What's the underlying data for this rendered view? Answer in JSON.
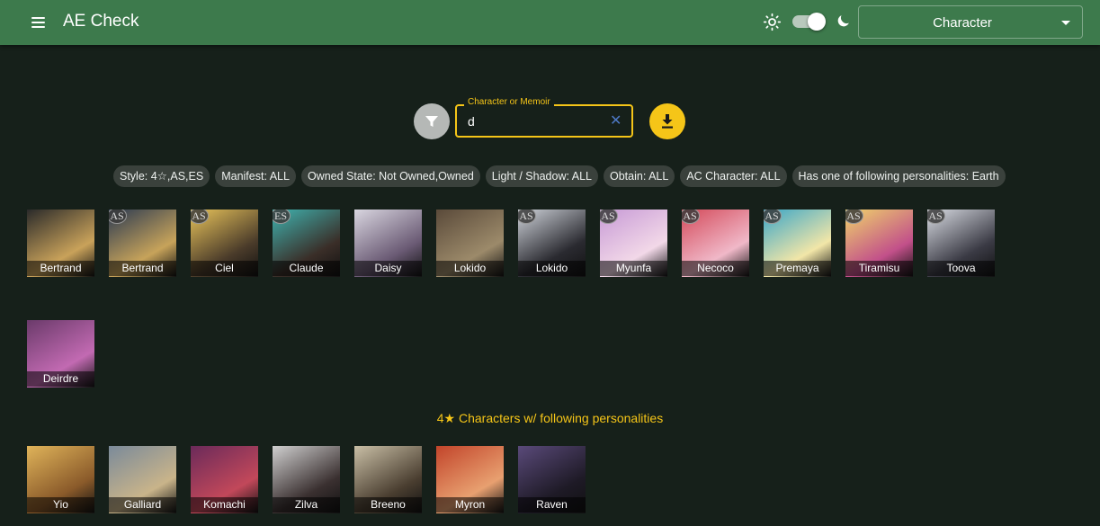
{
  "appbar": {
    "title": "AE Check",
    "dropdown_value": "Character"
  },
  "search": {
    "label": "Character or Memoir",
    "value": "d"
  },
  "filters": [
    "Style: 4☆,AS,ES",
    "Manifest: ALL",
    "Owned State: Not Owned,Owned",
    "Light / Shadow: ALL",
    "Obtain: ALL",
    "AC Character: ALL",
    "Has one of following personalities: Earth"
  ],
  "characters_row1": [
    {
      "name": "Bertrand",
      "badge": "",
      "colors": [
        "#2a2a2a",
        "#c9a25a"
      ]
    },
    {
      "name": "Bertrand",
      "badge": "AS",
      "colors": [
        "#2b3a52",
        "#c7a35a"
      ]
    },
    {
      "name": "Ciel",
      "badge": "AS",
      "colors": [
        "#e8c35a",
        "#4a3b2a"
      ]
    },
    {
      "name": "Claude",
      "badge": "ES",
      "colors": [
        "#3fb3b0",
        "#3a2e28"
      ]
    },
    {
      "name": "Daisy",
      "badge": "",
      "colors": [
        "#d9d6e0",
        "#6a5a74"
      ]
    },
    {
      "name": "Lokido",
      "badge": "",
      "colors": [
        "#5a4a3a",
        "#9c8a6a"
      ]
    },
    {
      "name": "Lokido",
      "badge": "AS",
      "colors": [
        "#cfd3da",
        "#2a2a30"
      ]
    },
    {
      "name": "Myunfa",
      "badge": "AS",
      "colors": [
        "#c79ad6",
        "#f2d8e8"
      ]
    },
    {
      "name": "Necoco",
      "badge": "AS",
      "colors": [
        "#d44a5a",
        "#f0b8c8"
      ]
    },
    {
      "name": "Premaya",
      "badge": "AS",
      "colors": [
        "#3aa6c8",
        "#f2e6a8"
      ]
    },
    {
      "name": "Tiramisu",
      "badge": "AS",
      "colors": [
        "#f0d46a",
        "#c2508a"
      ]
    },
    {
      "name": "Toova",
      "badge": "AS",
      "colors": [
        "#d9dce3",
        "#3a3a44"
      ]
    }
  ],
  "characters_row2": [
    {
      "name": "Deirdre",
      "badge": "",
      "colors": [
        "#6a3a6a",
        "#c26ab2"
      ]
    }
  ],
  "section_title": "4★ Characters w/ following personalities",
  "characters_row3": [
    {
      "name": "Yio",
      "badge": "",
      "colors": [
        "#e0b45a",
        "#8a5a2a"
      ]
    },
    {
      "name": "Galliard",
      "badge": "",
      "colors": [
        "#7a8a9a",
        "#c9b48a"
      ]
    },
    {
      "name": "Komachi",
      "badge": "",
      "colors": [
        "#6a2a5a",
        "#c2485a"
      ]
    },
    {
      "name": "Zilva",
      "badge": "",
      "colors": [
        "#d0d0d0",
        "#3a3030"
      ]
    },
    {
      "name": "Breeno",
      "badge": "",
      "colors": [
        "#c9bfa6",
        "#4a3e30"
      ]
    },
    {
      "name": "Myron",
      "badge": "",
      "colors": [
        "#c2442a",
        "#e8a070"
      ]
    },
    {
      "name": "Raven",
      "badge": "",
      "colors": [
        "#5a4a7a",
        "#1e1a26"
      ]
    }
  ]
}
